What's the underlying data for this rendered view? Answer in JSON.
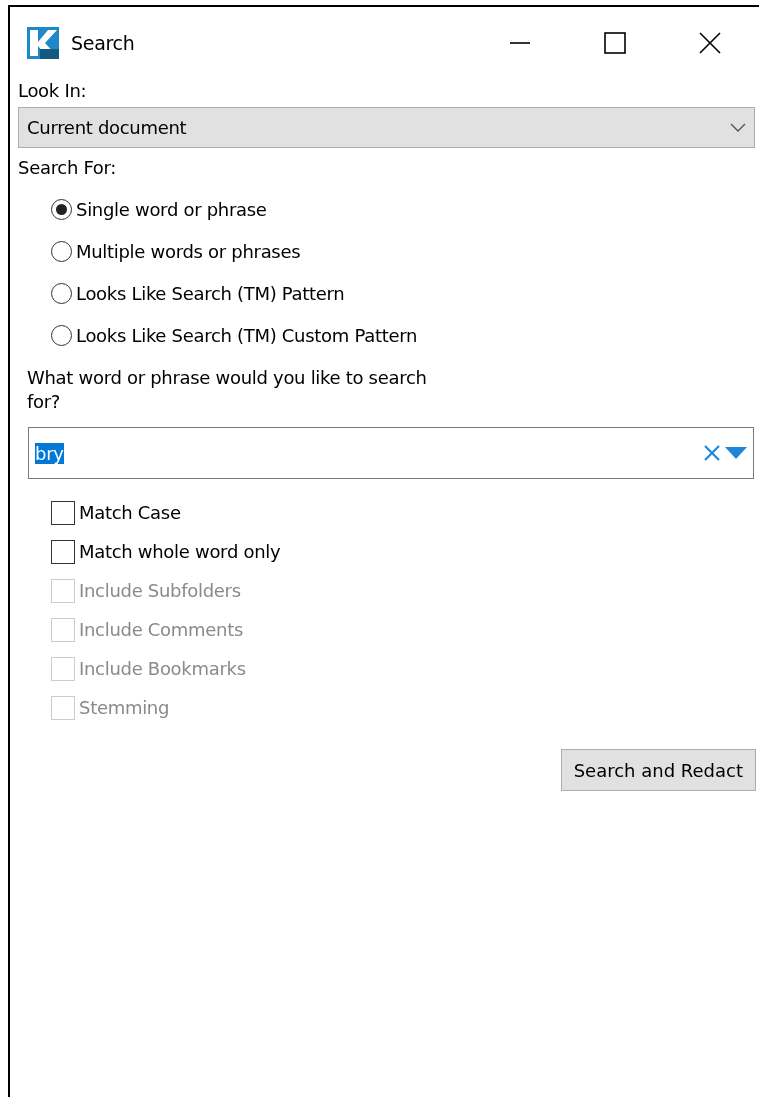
{
  "window": {
    "title": "Search"
  },
  "look_in": {
    "label": "Look In:",
    "value": "Current document"
  },
  "search_for": {
    "label": "Search For:",
    "options": [
      {
        "label": "Single word or phrase",
        "selected": true
      },
      {
        "label": "Multiple words or phrases",
        "selected": false
      },
      {
        "label": "Looks Like Search (TM) Pattern",
        "selected": false
      },
      {
        "label": "Looks Like Search (TM) Custom Pattern",
        "selected": false
      }
    ]
  },
  "query": {
    "label": "What word or phrase would you like to search for?",
    "value": "bry",
    "text_selected": true
  },
  "options": [
    {
      "label": "Match Case",
      "checked": false,
      "disabled": false
    },
    {
      "label": "Match whole word only",
      "checked": false,
      "disabled": false
    },
    {
      "label": "Include Subfolders",
      "checked": false,
      "disabled": true
    },
    {
      "label": "Include Comments",
      "checked": false,
      "disabled": true
    },
    {
      "label": "Include Bookmarks",
      "checked": false,
      "disabled": true
    },
    {
      "label": "Stemming",
      "checked": false,
      "disabled": true
    }
  ],
  "buttons": [
    {
      "label": "Search and Redact"
    }
  ]
}
